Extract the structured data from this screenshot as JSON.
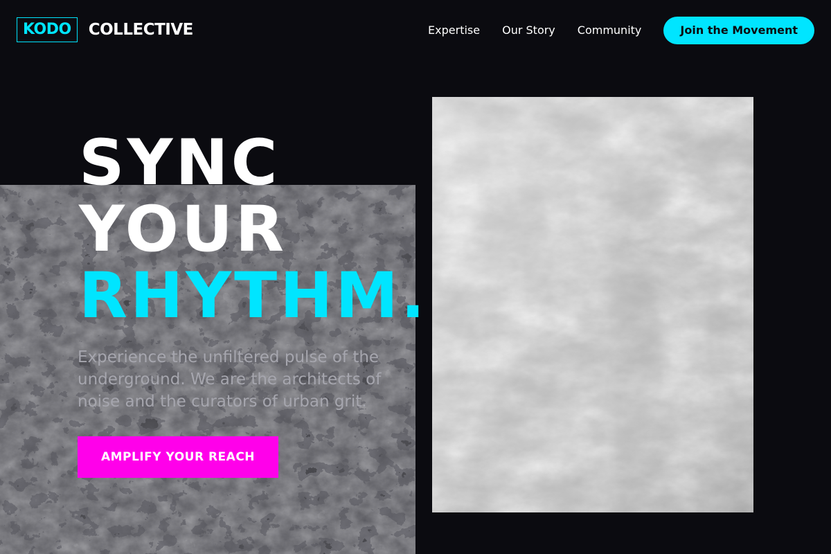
{
  "brand": {
    "box_text": "KODO",
    "word": "COLLECTIVE"
  },
  "nav": {
    "links": [
      "Expertise",
      "Our Story",
      "Community"
    ],
    "cta_label": "Join the Movement"
  },
  "hero": {
    "headline_lines": [
      "SYNC",
      "YOUR",
      "RHYTHM."
    ],
    "subcopy": "Experience the unfiltered pulse of the underground. We are the architects of noise and the curators of urban grit.",
    "cta_label": "AMPLIFY YOUR REACH"
  },
  "colors": {
    "background": "#0b0b10",
    "accent_cyan": "#00e5ff",
    "accent_magenta": "#ff00ea",
    "text_white": "#ffffff",
    "text_muted": "#a6a6ae"
  },
  "images": {
    "left_texture": "dark-grunge-texture",
    "right_texture": "grey-concrete-wall"
  }
}
